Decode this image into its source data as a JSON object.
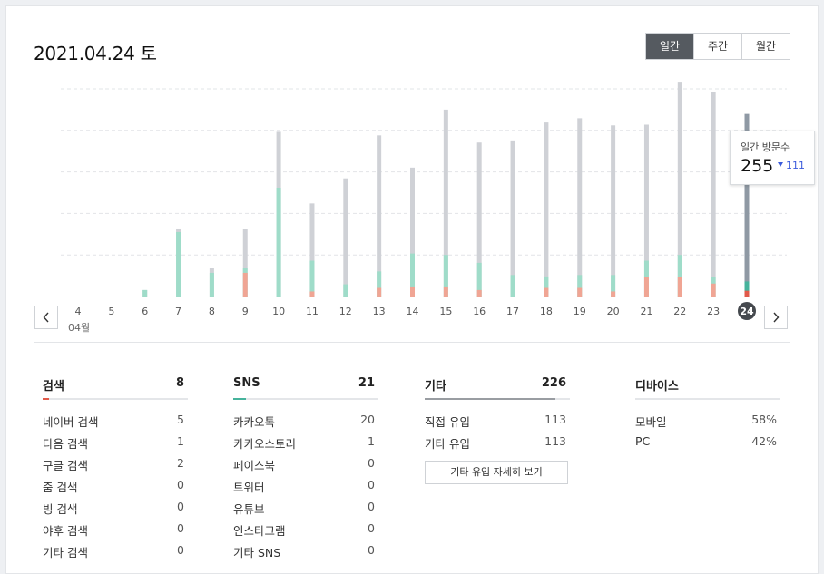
{
  "header": {
    "date_title": "2021.04.24 토",
    "period_tabs": [
      "일간",
      "주간",
      "월간"
    ],
    "active_tab": 0
  },
  "colors": {
    "total": "#cfd1d6",
    "total_selected": "#8f99a4",
    "sns": "#9fdcc9",
    "sns_selected": "#46b39c",
    "search": "#f0a594",
    "search_selected": "#e15a4a",
    "grid": "#e2e4e7",
    "accent_blue": "#3b5bdb"
  },
  "chart_data": {
    "type": "bar",
    "month_label": "04월",
    "categories": [
      "4",
      "5",
      "6",
      "7",
      "8",
      "9",
      "10",
      "11",
      "12",
      "13",
      "14",
      "15",
      "16",
      "17",
      "18",
      "19",
      "20",
      "21",
      "22",
      "23",
      "24"
    ],
    "selected_index": 20,
    "ylim": [
      0,
      290
    ],
    "series": [
      {
        "key": "total",
        "values": [
          0,
          0,
          9,
          95,
          40,
          94,
          230,
          130,
          165,
          225,
          180,
          261,
          215,
          218,
          243,
          249,
          239,
          240,
          300,
          286,
          255
        ]
      },
      {
        "key": "sns",
        "values": [
          0,
          0,
          9,
          90,
          33,
          40,
          152,
          50,
          17,
          35,
          60,
          58,
          47,
          30,
          28,
          30,
          30,
          50,
          58,
          27,
          21
        ]
      },
      {
        "key": "search",
        "values": [
          0,
          0,
          0,
          0,
          0,
          33,
          0,
          7,
          0,
          12,
          14,
          14,
          9,
          0,
          12,
          12,
          7,
          27,
          27,
          18,
          8
        ]
      }
    ],
    "tooltip": {
      "label": "일간 방문수",
      "value": "255",
      "change": "111"
    }
  },
  "stats": {
    "search": {
      "title": "검색",
      "total": "8",
      "items": [
        {
          "label": "네이버 검색",
          "value": "5"
        },
        {
          "label": "다음 검색",
          "value": "1"
        },
        {
          "label": "구글 검색",
          "value": "2"
        },
        {
          "label": "줌 검색",
          "value": "0"
        },
        {
          "label": "빙 검색",
          "value": "0"
        },
        {
          "label": "야후 검색",
          "value": "0"
        },
        {
          "label": "기타 검색",
          "value": "0"
        }
      ]
    },
    "sns": {
      "title": "SNS",
      "total": "21",
      "items": [
        {
          "label": "카카오톡",
          "value": "20"
        },
        {
          "label": "카카오스토리",
          "value": "1"
        },
        {
          "label": "페이스북",
          "value": "0"
        },
        {
          "label": "트위터",
          "value": "0"
        },
        {
          "label": "유튜브",
          "value": "0"
        },
        {
          "label": "인스타그램",
          "value": "0"
        },
        {
          "label": "기타 SNS",
          "value": "0"
        }
      ]
    },
    "etc": {
      "title": "기타",
      "total": "226",
      "items": [
        {
          "label": "직접 유입",
          "value": "113"
        },
        {
          "label": "기타 유입",
          "value": "113"
        }
      ],
      "detail_button": "기타 유입 자세히 보기"
    },
    "device": {
      "title": "디바이스",
      "items": [
        {
          "label": "모바일",
          "value": "58%"
        },
        {
          "label": "PC",
          "value": "42%"
        }
      ]
    }
  }
}
